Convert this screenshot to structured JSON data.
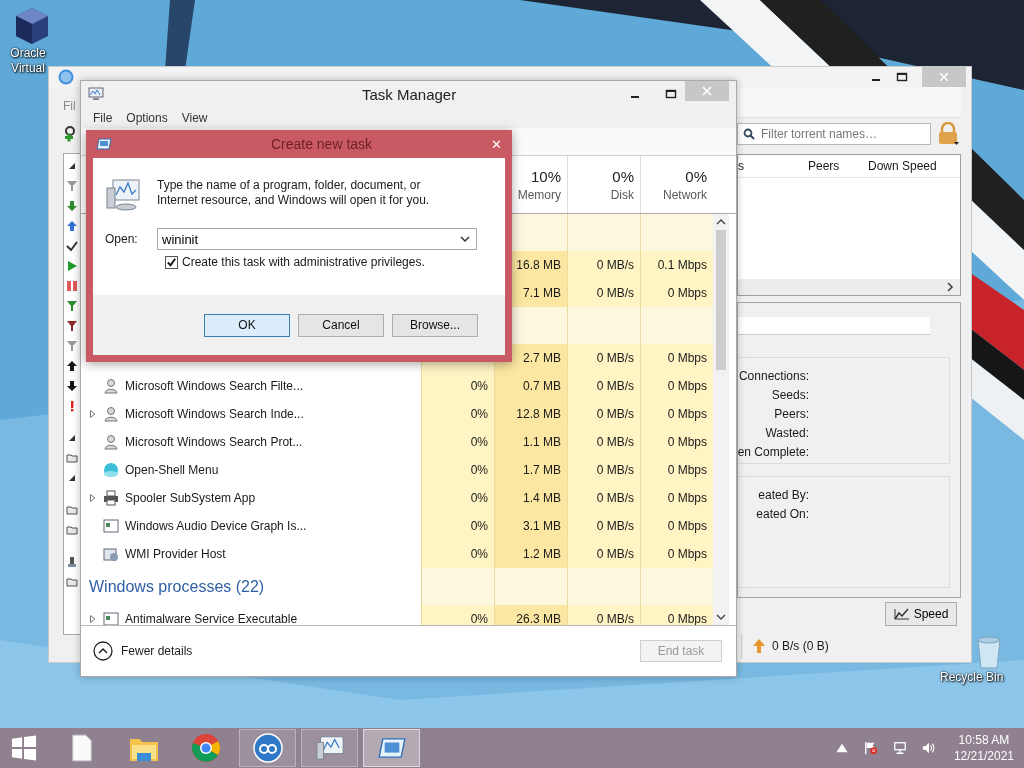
{
  "desktop_icons": [
    {
      "label": "Oracle Virtual"
    },
    {
      "label": "Recycle Bin"
    }
  ],
  "qbittorrent": {
    "menu": "Fil",
    "filter": {
      "placeholder": "Filter torrent names…"
    },
    "columns": [
      "s",
      "Peers",
      "Down Speed"
    ],
    "info_labels": [
      "Connections:",
      "Seeds:",
      "Peers:",
      "Wasted:",
      "en Complete:"
    ],
    "info_labels_2": [
      "eated By:",
      "eated On:"
    ],
    "speed_button": "Speed",
    "status": "0 B/s (0 B)"
  },
  "task_manager": {
    "title": "Task Manager",
    "menu": [
      "File",
      "Options",
      "View"
    ],
    "columns": [
      {
        "percent": "10%",
        "label": "Memory"
      },
      {
        "percent": "0%",
        "label": "Disk"
      },
      {
        "percent": "0%",
        "label": "Network"
      }
    ],
    "rows": [
      {
        "kind": "group"
      },
      {
        "kind": "process",
        "memory": "16.8 MB",
        "disk": "0 MB/s",
        "network": "0.1 Mbps"
      },
      {
        "kind": "process",
        "memory": "7.1 MB",
        "disk": "0 MB/s",
        "network": "0 Mbps"
      },
      {
        "kind": "group"
      },
      {
        "kind": "process",
        "memory": "2.7 MB",
        "disk": "0 MB/s",
        "network": "0 Mbps"
      },
      {
        "kind": "process",
        "name": "Microsoft Windows Search Filte...",
        "expandable": false,
        "cpu": "0%",
        "memory": "0.7 MB",
        "disk": "0 MB/s",
        "network": "0 Mbps"
      },
      {
        "kind": "process",
        "name": "Microsoft Windows Search Inde...",
        "expandable": true,
        "cpu": "0%",
        "memory": "12.8 MB",
        "disk": "0 MB/s",
        "network": "0 Mbps"
      },
      {
        "kind": "process",
        "name": "Microsoft Windows Search Prot...",
        "expandable": false,
        "cpu": "0%",
        "memory": "1.1 MB",
        "disk": "0 MB/s",
        "network": "0 Mbps"
      },
      {
        "kind": "process",
        "name": "Open-Shell Menu",
        "expandable": false,
        "cpu": "0%",
        "memory": "1.7 MB",
        "disk": "0 MB/s",
        "network": "0 Mbps"
      },
      {
        "kind": "process",
        "name": "Spooler SubSystem App",
        "expandable": true,
        "cpu": "0%",
        "memory": "1.4 MB",
        "disk": "0 MB/s",
        "network": "0 Mbps"
      },
      {
        "kind": "process",
        "name": "Windows Audio Device Graph Is...",
        "expandable": false,
        "cpu": "0%",
        "memory": "3.1 MB",
        "disk": "0 MB/s",
        "network": "0 Mbps"
      },
      {
        "kind": "process",
        "name": "WMI Provider Host",
        "expandable": false,
        "cpu": "0%",
        "memory": "1.2 MB",
        "disk": "0 MB/s",
        "network": "0 Mbps"
      },
      {
        "kind": "group",
        "label": "Windows processes (22)"
      },
      {
        "kind": "process",
        "name": "Antimalware Service Executable",
        "expandable": true,
        "cpu": "0%",
        "memory": "26.3 MB",
        "disk": "0 MB/s",
        "network": "0 Mbps"
      }
    ],
    "footer": {
      "toggle": "Fewer details",
      "end_task": {
        "label": "End task",
        "disabled": true
      }
    }
  },
  "dialog": {
    "title": "Create new task",
    "close": "✕",
    "message": "Type the name of a program, folder, document, or Internet resource, and Windows will open it for you.",
    "open_label": "Open:",
    "value": "wininit",
    "admin": {
      "label": "Create this task with administrative privileges.",
      "checked": true
    },
    "buttons": [
      {
        "label": "OK",
        "default": true
      },
      {
        "label": "Cancel",
        "default": false
      },
      {
        "label": "Browse...",
        "default": false
      }
    ]
  },
  "taskbar": {
    "apps": [
      {
        "running": false,
        "selected": false
      },
      {
        "running": false,
        "selected": false
      },
      {
        "running": false,
        "selected": false
      },
      {
        "running": true,
        "selected": false
      },
      {
        "running": true,
        "selected": false
      },
      {
        "running": true,
        "selected": true
      }
    ],
    "clock": {
      "time": "10:58 AM",
      "date": "12/21/2021"
    }
  }
}
